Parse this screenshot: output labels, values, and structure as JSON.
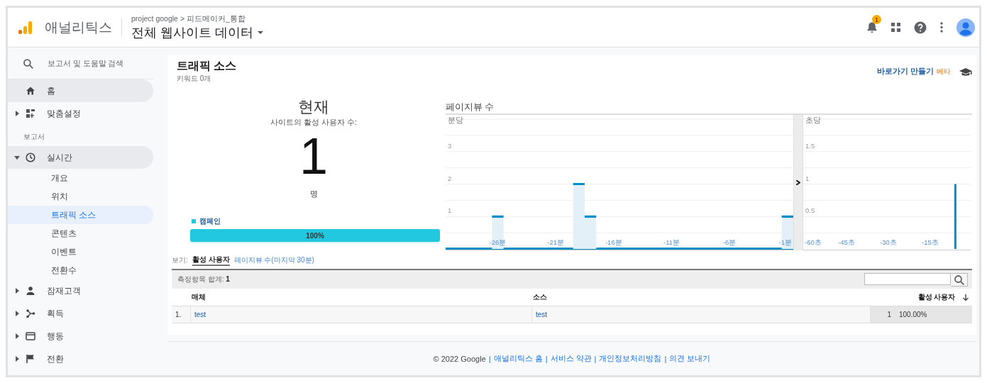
{
  "header": {
    "product": "애널리틱스",
    "breadcrumb": "project google > 피드메이커_통합",
    "view": "전체 웹사이트 데이터",
    "notifications": "1"
  },
  "sidebar": {
    "search": {
      "placeholder": "보고서 및 도움말 검색"
    },
    "items": [
      {
        "kind": "item",
        "label": "홈",
        "expandable": false,
        "expanded": false,
        "highlighted": true
      },
      {
        "kind": "item",
        "label": "맞춤설정",
        "expandable": true,
        "expanded": false,
        "highlighted": false
      },
      {
        "kind": "section",
        "label": "보고서"
      },
      {
        "kind": "item",
        "label": "실시간",
        "expandable": true,
        "expanded": true,
        "highlighted": true,
        "children": [
          {
            "label": "개요",
            "selected": false
          },
          {
            "label": "위치",
            "selected": false
          },
          {
            "label": "트래픽 소스",
            "selected": true
          },
          {
            "label": "콘텐츠",
            "selected": false
          },
          {
            "label": "이벤트",
            "selected": false
          },
          {
            "label": "전환수",
            "selected": false
          }
        ]
      },
      {
        "kind": "item",
        "label": "잠재고객",
        "expandable": true,
        "expanded": false,
        "highlighted": false
      },
      {
        "kind": "item",
        "label": "획득",
        "expandable": true,
        "expanded": false,
        "highlighted": false
      },
      {
        "kind": "item",
        "label": "행동",
        "expandable": true,
        "expanded": false,
        "highlighted": false
      },
      {
        "kind": "item",
        "label": "전환",
        "expandable": true,
        "expanded": false,
        "highlighted": false
      }
    ]
  },
  "report": {
    "title": "트래픽 소스",
    "subtitle": "키워드 0개",
    "shortcut": "바로가기 만들기",
    "beta": "베타",
    "now": {
      "heading": "현재",
      "caption": "사이트의 활성 사용자 수:",
      "count": "1",
      "unit": "명",
      "legend": "캠페인",
      "bar": {
        "label": "100%",
        "level": 1
      }
    },
    "pageviews": {
      "heading": "페이지뷰 수",
      "charts": [
        {
          "chart_data": {
            "type": "bar",
            "title": "분당",
            "x": [
              -30,
              -29,
              -28,
              -27,
              -26,
              -25,
              -24,
              -23,
              -22,
              -21,
              -20,
              -19,
              -18,
              -17,
              -16,
              -15,
              -14,
              -13,
              -12,
              -11,
              -10,
              -9,
              -8,
              -7,
              -6,
              -5,
              -4,
              -3,
              -2,
              -1
            ],
            "values": [
              0,
              0,
              0,
              0,
              1,
              0,
              0,
              0,
              0,
              0,
              0,
              2,
              1,
              0,
              0,
              0,
              0,
              0,
              0,
              0,
              0,
              0,
              0,
              0,
              0,
              0,
              0,
              0,
              0,
              1
            ],
            "xlim": [
              -30.5,
              -0.5
            ],
            "ylim": [
              0,
              4
            ],
            "yticks": [
              1,
              2,
              3
            ],
            "grid": true,
            "xticks": [
              {
                "value": -26,
                "label": "-26분"
              },
              {
                "value": -21,
                "label": "-21분"
              },
              {
                "value": -16,
                "label": "-16분"
              },
              {
                "value": -11,
                "label": "-11분"
              },
              {
                "value": -6,
                "label": "-6분"
              },
              {
                "value": -1,
                "label": "-1분"
              }
            ]
          }
        },
        {
          "chart_data": {
            "type": "bar",
            "title": "초당",
            "x": [
              -60,
              -59,
              -58,
              -57,
              -56,
              -55,
              -54,
              -53,
              -52,
              -51,
              -50,
              -49,
              -48,
              -47,
              -46,
              -45,
              -44,
              -43,
              -42,
              -41,
              -40,
              -39,
              -38,
              -37,
              -36,
              -35,
              -34,
              -33,
              -32,
              -31,
              -30,
              -29,
              -28,
              -27,
              -26,
              -25,
              -24,
              -23,
              -22,
              -21,
              -20,
              -19,
              -18,
              -17,
              -16,
              -15,
              -14,
              -13,
              -12,
              -11,
              -10,
              -9,
              -8,
              -7,
              -6,
              -5,
              -4,
              -3,
              -2,
              -1
            ],
            "values": [
              0,
              0,
              0,
              0,
              0,
              0,
              0,
              0,
              0,
              0,
              0,
              0,
              0,
              0,
              0,
              0,
              0,
              0,
              0,
              0,
              0,
              0,
              0,
              0,
              0,
              0,
              0,
              0,
              0,
              0,
              0,
              0,
              0,
              0,
              0,
              0,
              0,
              0,
              0,
              0,
              0,
              0,
              0,
              0,
              0,
              0,
              0,
              0,
              0,
              0,
              0,
              0,
              0,
              0,
              1,
              0,
              0,
              0,
              0,
              0
            ],
            "xlim": [
              -60.5,
              -0.5
            ],
            "ylim": [
              0,
              2
            ],
            "yticks": [
              0.5,
              1,
              1.5
            ],
            "grid": true,
            "xticks": [
              {
                "value": -60,
                "label": "-60초"
              },
              {
                "value": -45,
                "label": "-45초"
              },
              {
                "value": -30,
                "label": "-30초"
              },
              {
                "value": -15,
                "label": "-15초"
              }
            ]
          }
        }
      ]
    },
    "views": {
      "label": "보기:",
      "options": [
        {
          "label": "활성 사용자",
          "selected": true
        },
        {
          "label": "페이지뷰 수(마지막 30분)",
          "selected": false
        }
      ]
    },
    "table": {
      "total_label": "측정항목 합계:",
      "total": "1",
      "columns": [
        "매체",
        "소스",
        "활성 사용자"
      ],
      "rows": [
        {
          "index": "1.",
          "medium": "test",
          "source": "test",
          "users": "1",
          "share": "100.00%"
        }
      ]
    }
  },
  "footer": {
    "copyright": "© 2022 Google",
    "separator": "|",
    "links": [
      "애널리틱스 홈",
      "서비스 약관",
      "개인정보처리방침",
      "의견 보내기"
    ]
  }
}
